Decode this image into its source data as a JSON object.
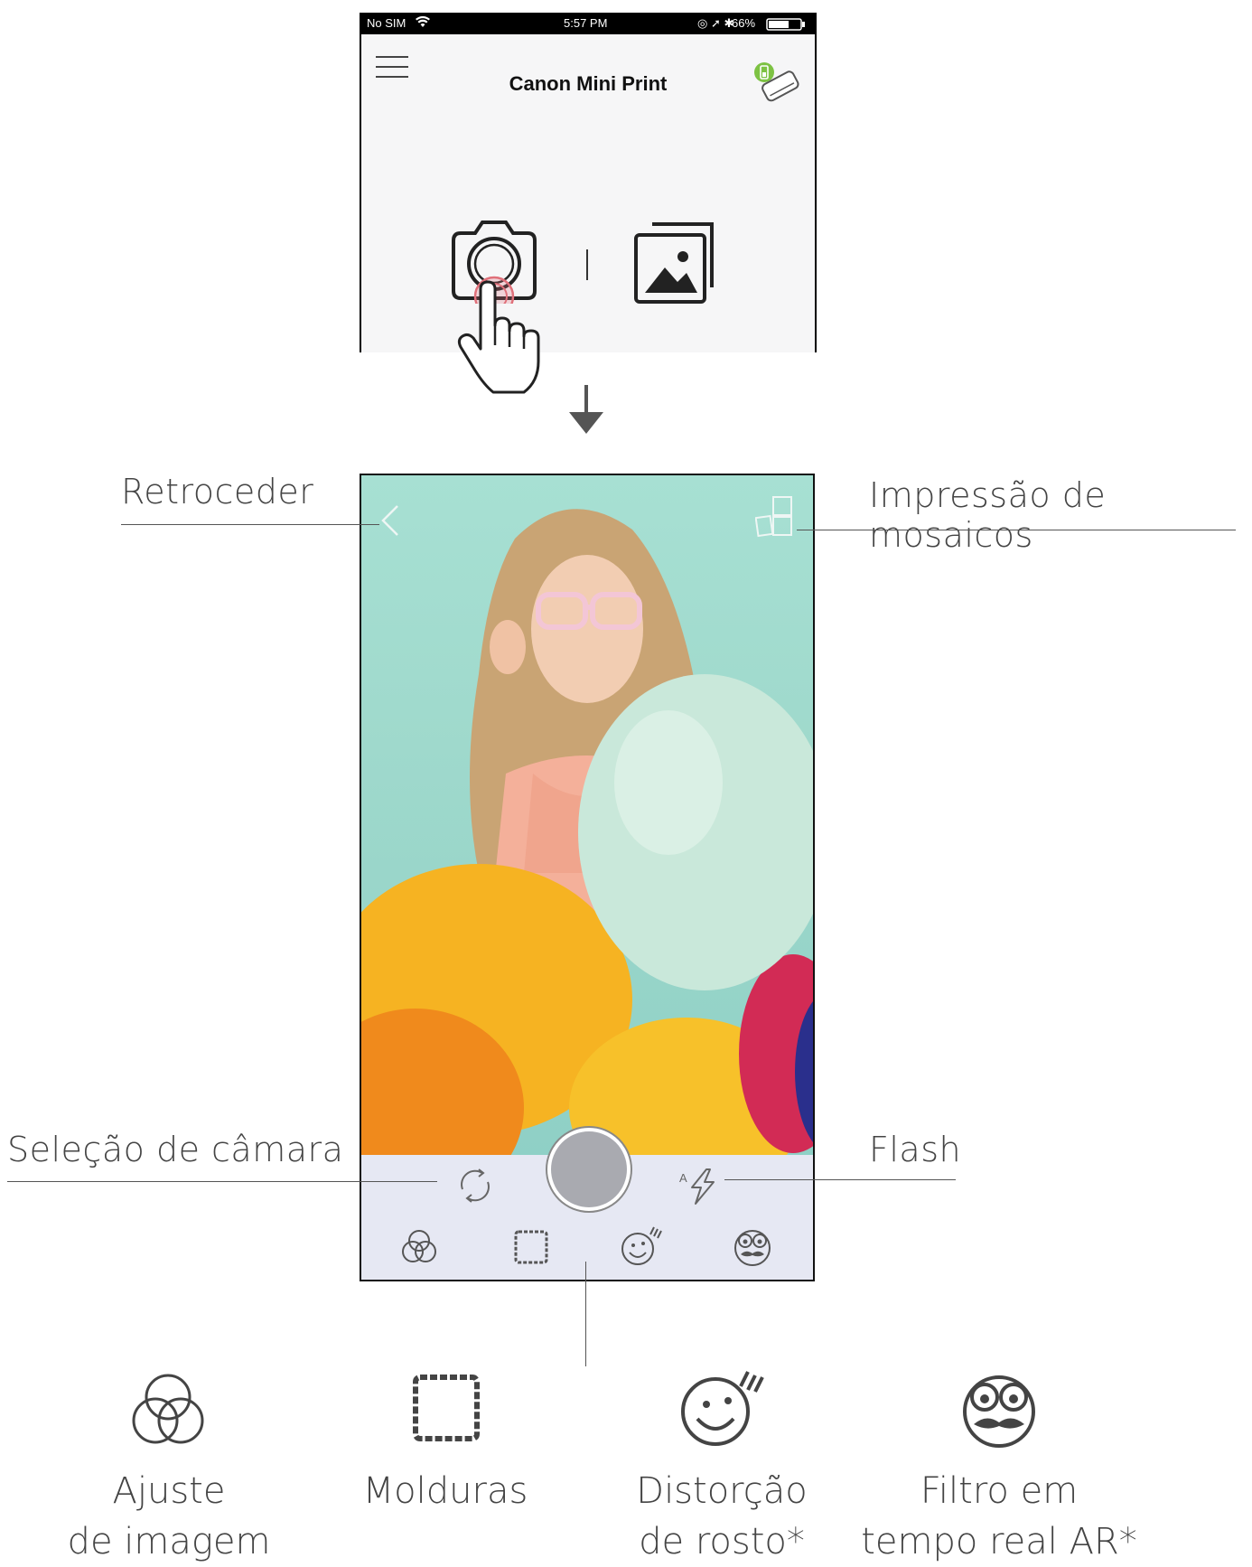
{
  "status_bar": {
    "carrier": "No SIM",
    "time": "5:57 PM",
    "battery": "66%"
  },
  "app": {
    "title": "Canon Mini Print"
  },
  "home": {
    "icons": [
      "hamburger-menu-icon",
      "printer-status-icon",
      "camera-icon",
      "gallery-icon",
      "hand-pointer-icon"
    ]
  },
  "callouts": {
    "back": "Retroceder",
    "tile_print": "Impressão de mosaicos",
    "camera_select": "Seleção de câmara",
    "flash": "Flash"
  },
  "toolbar": {
    "icons": [
      "switch-camera-icon",
      "shutter-button",
      "flash-auto-icon",
      "image-adjust-icon",
      "frames-icon",
      "face-distortion-icon",
      "ar-filter-icon"
    ],
    "flash_mode": "A"
  },
  "legend": {
    "image_adjust_line1": "Ajuste",
    "image_adjust_line2": "de imagem",
    "frames": "Molduras",
    "face_distortion_line1": "Distorção",
    "face_distortion_line2": "de rosto*",
    "ar_filter_line1": "Filtro em",
    "ar_filter_line2": "tempo real AR*"
  },
  "colors": {
    "photo_bg": "#a7e0d3",
    "toolbar_bg": "#e6e8f3",
    "tap_highlight": "#e0707a"
  }
}
